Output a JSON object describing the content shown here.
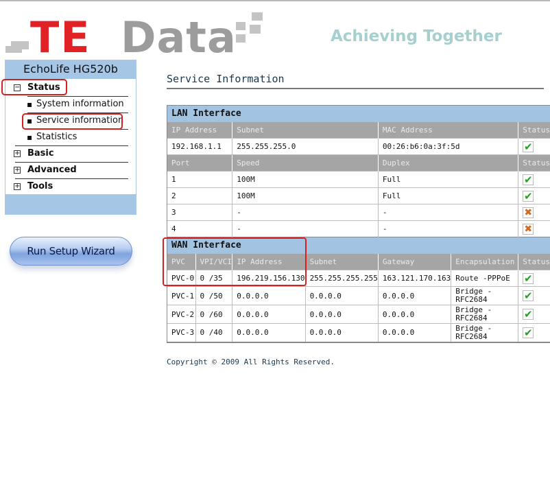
{
  "brand": {
    "logo_part1": "TE",
    "logo_part2": "Data",
    "slogan": "Achieving Together",
    "colors": {
      "red": "#e02226",
      "gray": "#9c9c9c",
      "slogan": "#a6cfcf",
      "nav": "#a6c6e6"
    }
  },
  "nav": {
    "device": "EchoLife HG520b",
    "menu": [
      {
        "label": "Status",
        "expander": "−",
        "children": [
          "System information",
          "Service information",
          "Statistics"
        ]
      },
      {
        "label": "Basic",
        "expander": "+"
      },
      {
        "label": "Advanced",
        "expander": "+"
      },
      {
        "label": "Tools",
        "expander": "+"
      }
    ],
    "wizard_label": "Run Setup Wizard"
  },
  "page": {
    "title": "Service Information",
    "copyright": "Copyright © 2009 All Rights Reserved."
  },
  "lan": {
    "title": "LAN Interface",
    "headers": [
      "IP Address",
      "Subnet",
      "MAC Address",
      "Status"
    ],
    "row": {
      "ip": "192.168.1.1",
      "subnet": "255.255.255.0",
      "mac": "00:26:b6:0a:3f:5d",
      "status": "ok"
    },
    "port_headers": [
      "Port",
      "Speed",
      "Duplex",
      "Status"
    ],
    "ports": [
      {
        "port": "1",
        "speed": "100M",
        "duplex": "Full",
        "status": "ok"
      },
      {
        "port": "2",
        "speed": "100M",
        "duplex": "Full",
        "status": "ok"
      },
      {
        "port": "3",
        "speed": "-",
        "duplex": "-",
        "status": "bad"
      },
      {
        "port": "4",
        "speed": "-",
        "duplex": "-",
        "status": "bad"
      }
    ]
  },
  "wan": {
    "title": "WAN Interface",
    "headers": [
      "PVC",
      "VPI/VCI",
      "IP Address",
      "Subnet",
      "Gateway",
      "Encapsulation",
      "Status"
    ],
    "rows": [
      {
        "pvc": "PVC-0",
        "vpivci": "0 /35",
        "ip": "196.219.156.130",
        "subnet": "255.255.255.255",
        "gateway": "163.121.170.163",
        "encap": "Route -PPPoE",
        "status": "ok"
      },
      {
        "pvc": "PVC-1",
        "vpivci": "0 /50",
        "ip": "0.0.0.0",
        "subnet": "0.0.0.0",
        "gateway": "0.0.0.0",
        "encap": "Bridge -RFC2684",
        "status": "ok"
      },
      {
        "pvc": "PVC-2",
        "vpivci": "0 /60",
        "ip": "0.0.0.0",
        "subnet": "0.0.0.0",
        "gateway": "0.0.0.0",
        "encap": "Bridge -RFC2684",
        "status": "ok"
      },
      {
        "pvc": "PVC-3",
        "vpivci": "0 /40",
        "ip": "0.0.0.0",
        "subnet": "0.0.0.0",
        "gateway": "0.0.0.0",
        "encap": "Bridge -RFC2684",
        "status": "ok"
      }
    ]
  },
  "status_icons": {
    "ok": "✔",
    "bad": "✖"
  }
}
